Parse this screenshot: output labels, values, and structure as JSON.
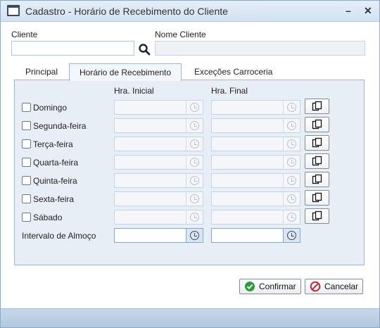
{
  "window": {
    "title": "Cadastro - Horário de Recebimento do Cliente",
    "minimize_label": "–",
    "close_label": "✕"
  },
  "header": {
    "cliente_label": "Cliente",
    "cliente_value": "",
    "nome_cliente_label": "Nome Cliente",
    "nome_cliente_value": ""
  },
  "tabs": [
    {
      "label": "Principal",
      "active": false
    },
    {
      "label": "Horário de Recebimento",
      "active": true
    },
    {
      "label": "Exceções Carroceria",
      "active": false
    }
  ],
  "schedule": {
    "col_initial": "Hra. Inicial",
    "col_final": "Hra. Final",
    "days": [
      {
        "label": "Domingo",
        "checked": false,
        "start": "",
        "end": ""
      },
      {
        "label": "Segunda-feira",
        "checked": false,
        "start": "",
        "end": ""
      },
      {
        "label": "Terça-feira",
        "checked": false,
        "start": "",
        "end": ""
      },
      {
        "label": "Quarta-feira",
        "checked": false,
        "start": "",
        "end": ""
      },
      {
        "label": "Quinta-feira",
        "checked": false,
        "start": "",
        "end": ""
      },
      {
        "label": "Sexta-feira",
        "checked": false,
        "start": "",
        "end": ""
      },
      {
        "label": "Sábado",
        "checked": false,
        "start": "",
        "end": ""
      }
    ],
    "lunch_label": "Intervalo de Almoço",
    "lunch_start": "",
    "lunch_end": ""
  },
  "footer": {
    "confirm_label": "Confirmar",
    "cancel_label": "Cancelar"
  },
  "colors": {
    "titlebar": "#d3e2f3",
    "panel": "#e8eef5",
    "confirm_icon": "#2a9d3a",
    "cancel_icon": "#c0282d"
  }
}
